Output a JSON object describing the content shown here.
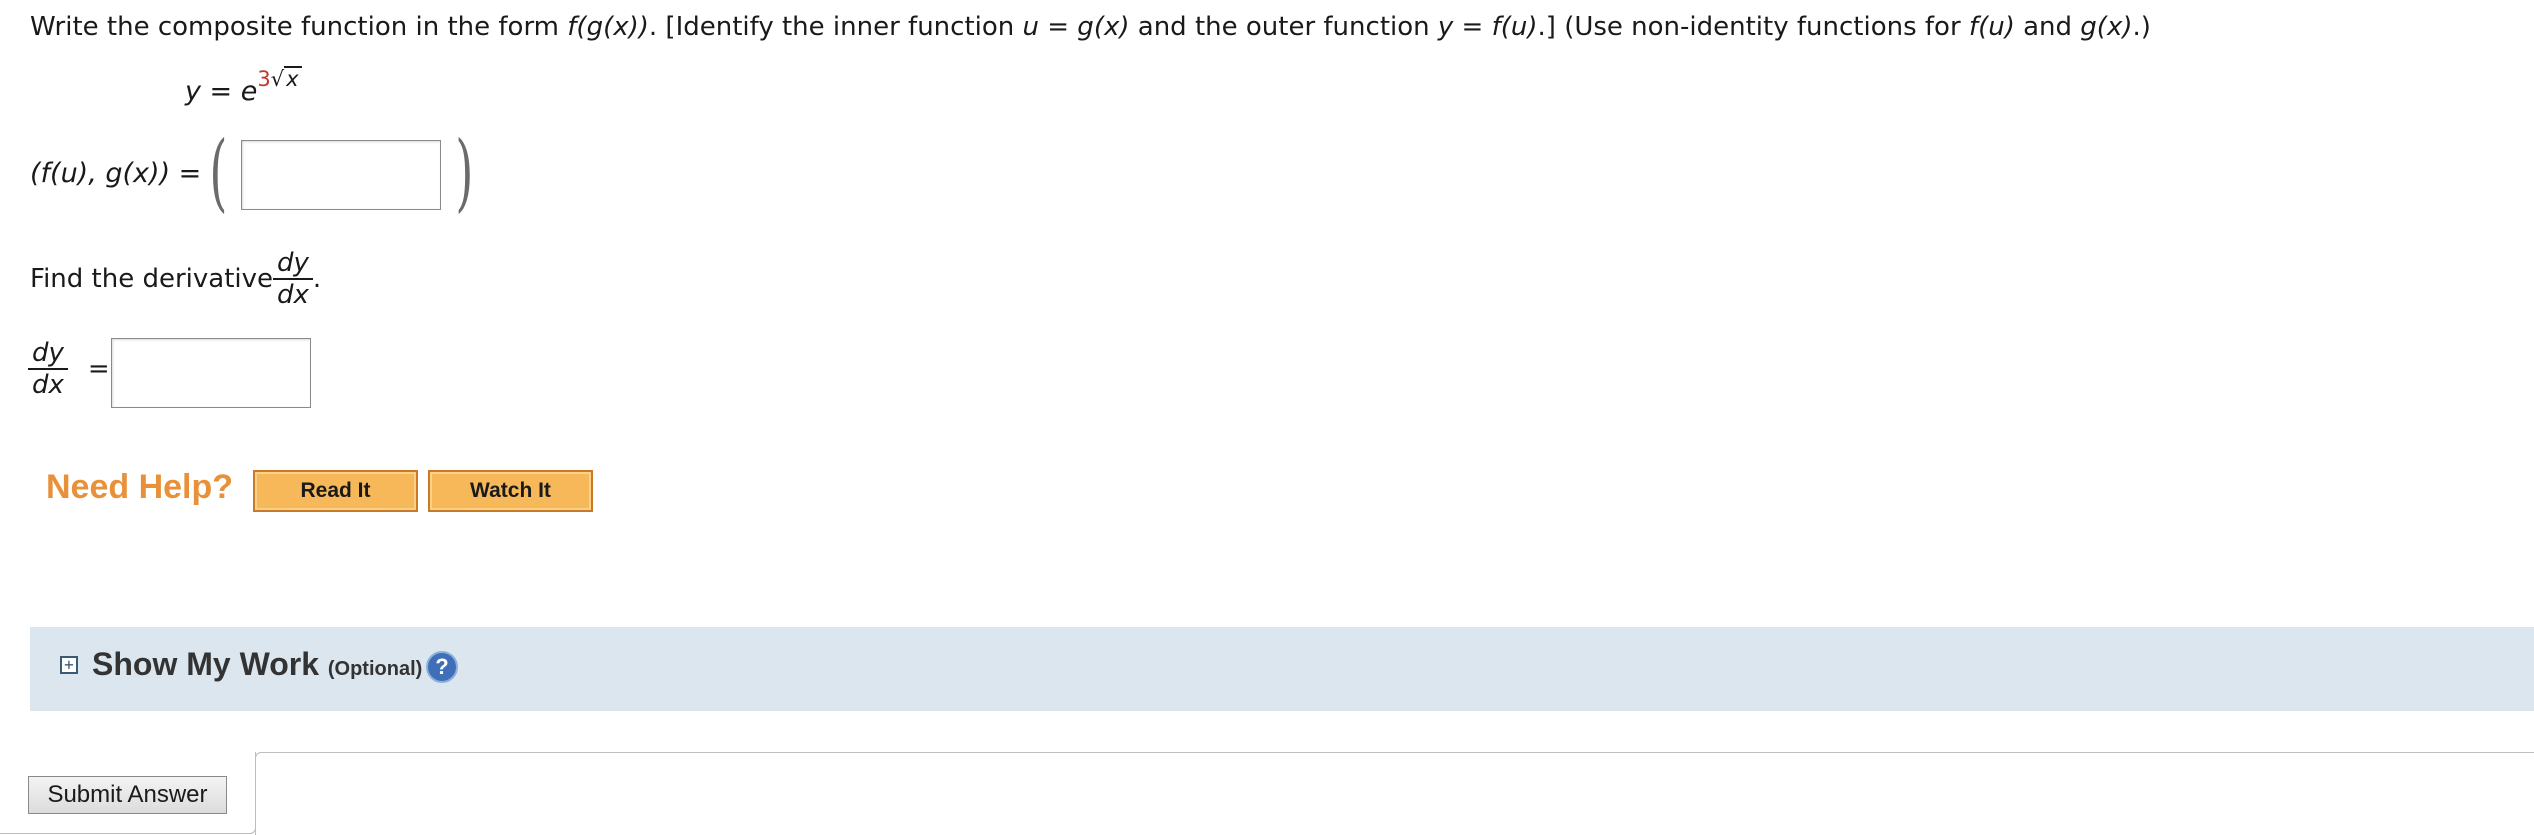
{
  "question": {
    "prefix": "Write the composite function in the form ",
    "form": "f(g(x))",
    "identify_prefix": ". [Identify the inner function ",
    "inner": "u = g(x)",
    "identify_mid": " and the outer function ",
    "outer": "y = f(u)",
    "suffix_a": ".] (Use non-identity functions for ",
    "fu": "f(u)",
    "and": " and ",
    "gx": "g(x)",
    "suffix_b": ".)"
  },
  "equation": {
    "lhs": "y = e",
    "index": "3",
    "radical": "√",
    "radicand": "x"
  },
  "composite": {
    "label": "(f(u), g(x)) =",
    "answer_value": ""
  },
  "derivative": {
    "prompt": "Find the derivative ",
    "num": "dy",
    "den": "dx",
    "period": ".",
    "lhs_num": "dy",
    "lhs_den": "dx",
    "equals": "=",
    "answer_value": ""
  },
  "help": {
    "title": "Need Help?",
    "read_it": "Read It",
    "watch_it": "Watch It"
  },
  "show_my_work": {
    "toggle": "+",
    "title": "Show My Work",
    "optional": "(Optional)",
    "help_icon": "?"
  },
  "submit": {
    "label": "Submit Answer"
  }
}
